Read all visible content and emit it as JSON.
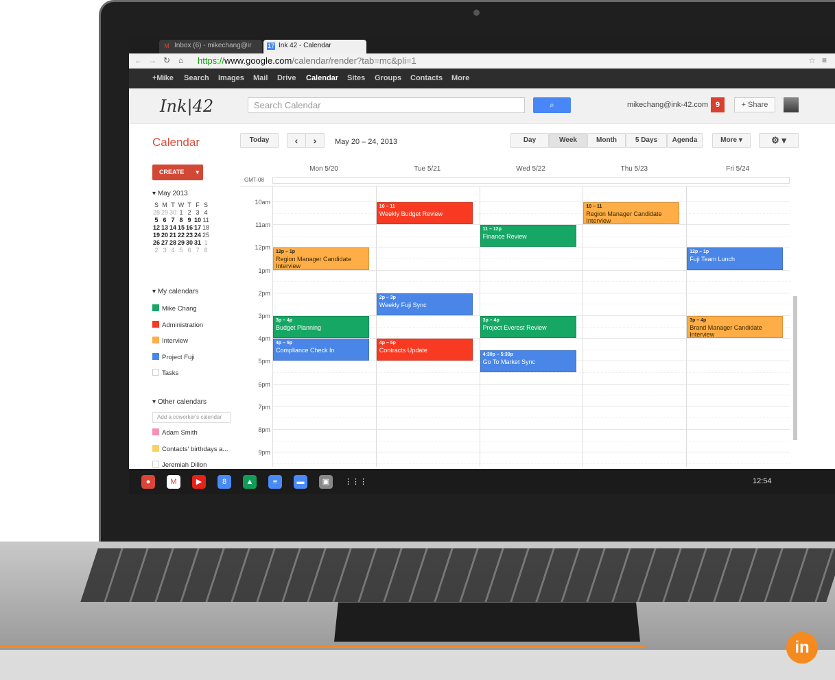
{
  "browser": {
    "tabs": [
      {
        "label": "Inbox (6) - mikechang@ir",
        "icon": "gmail-icon"
      },
      {
        "label": "Ink 42 - Calendar",
        "icon": "calendar-icon"
      }
    ],
    "url_scheme": "https://",
    "url_host": "www.google.com",
    "url_path": "/calendar/render?tab=mc&pli=1"
  },
  "gbar": {
    "items": [
      "+Mike",
      "Search",
      "Images",
      "Mail",
      "Drive",
      "Calendar",
      "Sites",
      "Groups",
      "Contacts",
      "More"
    ],
    "active": "Calendar"
  },
  "header": {
    "brand": "Ink|42",
    "search_placeholder": "Search Calendar",
    "account": "mikechang@ink-42.com",
    "notif_count": "9",
    "share_label": "+ Share"
  },
  "toolbar": {
    "title": "Calendar",
    "today": "Today",
    "range": "May 20 – 24, 2013",
    "views": [
      "Day",
      "Week",
      "Month",
      "5 Days",
      "Agenda"
    ],
    "active_view": "Week",
    "more": "More",
    "prev": "‹",
    "next": "›"
  },
  "sidebar": {
    "create": "CREATE",
    "month": "May 2013",
    "weekdays": [
      "S",
      "M",
      "T",
      "W",
      "T",
      "F",
      "S"
    ],
    "weeks": [
      [
        "28",
        "29",
        "30",
        "1",
        "2",
        "3",
        "4"
      ],
      [
        "5",
        "6",
        "7",
        "8",
        "9",
        "10",
        "11"
      ],
      [
        "12",
        "13",
        "14",
        "15",
        "16",
        "17",
        "18"
      ],
      [
        "19",
        "20",
        "21",
        "22",
        "23",
        "24",
        "25"
      ],
      [
        "26",
        "27",
        "28",
        "29",
        "30",
        "31",
        "1"
      ],
      [
        "2",
        "3",
        "4",
        "5",
        "6",
        "7",
        "8"
      ]
    ],
    "my_calendars_label": "My calendars",
    "my_calendars": [
      {
        "name": "Mike Chang",
        "color": "#16a765"
      },
      {
        "name": "Administration",
        "color": "#f83a22"
      },
      {
        "name": "Interview",
        "color": "#ffad46"
      },
      {
        "name": "Project Fuji",
        "color": "#4986e7"
      },
      {
        "name": "Tasks",
        "color": ""
      }
    ],
    "other_calendars_label": "Other calendars",
    "add_coworker": "Add a coworker's calendar",
    "other_calendars": [
      {
        "name": "Adam Smith",
        "color": "#f691b2"
      },
      {
        "name": "Contacts' birthdays a...",
        "color": "#fad165"
      },
      {
        "name": "Jeremiah Dillon",
        "color": ""
      }
    ]
  },
  "grid": {
    "tz": "GMT-08",
    "days": [
      "Mon 5/20",
      "Tue 5/21",
      "Wed 5/22",
      "Thu 5/23",
      "Fri 5/24"
    ],
    "hours": [
      "10am",
      "11am",
      "12pm",
      "1pm",
      "2pm",
      "3pm",
      "4pm",
      "5pm",
      "6pm",
      "7pm",
      "8pm",
      "9pm"
    ],
    "events": [
      {
        "day": 1,
        "start": 10,
        "end": 11,
        "time": "10 – 11",
        "title": "Weekly Budget Review",
        "color": "#f83a22"
      },
      {
        "day": 3,
        "start": 10,
        "end": 11,
        "time": "10 – 11",
        "title": "Region Manager Candidate Interview",
        "color": "#ffad46"
      },
      {
        "day": 2,
        "start": 11,
        "end": 12,
        "time": "11 – 12p",
        "title": "Finance Review",
        "color": "#16a765"
      },
      {
        "day": 0,
        "start": 12,
        "end": 13,
        "time": "12p – 1p",
        "title": "Region Manager Candidate Interview",
        "color": "#ffad46"
      },
      {
        "day": 4,
        "start": 12,
        "end": 13,
        "time": "12p – 1p",
        "title": "Fuji Team Lunch",
        "color": "#4986e7"
      },
      {
        "day": 1,
        "start": 14,
        "end": 15,
        "time": "2p – 3p",
        "title": "Weekly Fuji Sync",
        "color": "#4986e7"
      },
      {
        "day": 0,
        "start": 15,
        "end": 16,
        "time": "3p – 4p",
        "title": "Budget Planning",
        "color": "#16a765"
      },
      {
        "day": 2,
        "start": 15,
        "end": 16,
        "time": "3p – 4p",
        "title": "Project Everest Review",
        "color": "#16a765"
      },
      {
        "day": 4,
        "start": 15,
        "end": 16,
        "time": "3p – 4p",
        "title": "Brand Manager Candidate Interview",
        "color": "#ffad46"
      },
      {
        "day": 0,
        "start": 16,
        "end": 17,
        "time": "4p – 5p",
        "title": "Compliance Check In",
        "color": "#4986e7"
      },
      {
        "day": 1,
        "start": 16,
        "end": 17,
        "time": "4p – 5p",
        "title": "Contracts Update",
        "color": "#f83a22"
      },
      {
        "day": 2,
        "start": 16.5,
        "end": 17.5,
        "time": "4:30p – 5:30p",
        "title": "Go To Market Sync",
        "color": "#4986e7"
      }
    ]
  },
  "shelf": {
    "apps": [
      "chrome-icon",
      "gmail-icon",
      "youtube-icon",
      "google-plus-icon",
      "drive-icon",
      "docs-icon",
      "files-icon",
      "terminal-icon",
      "apps-grid-icon"
    ],
    "clock": "12:54"
  },
  "badge": "in"
}
